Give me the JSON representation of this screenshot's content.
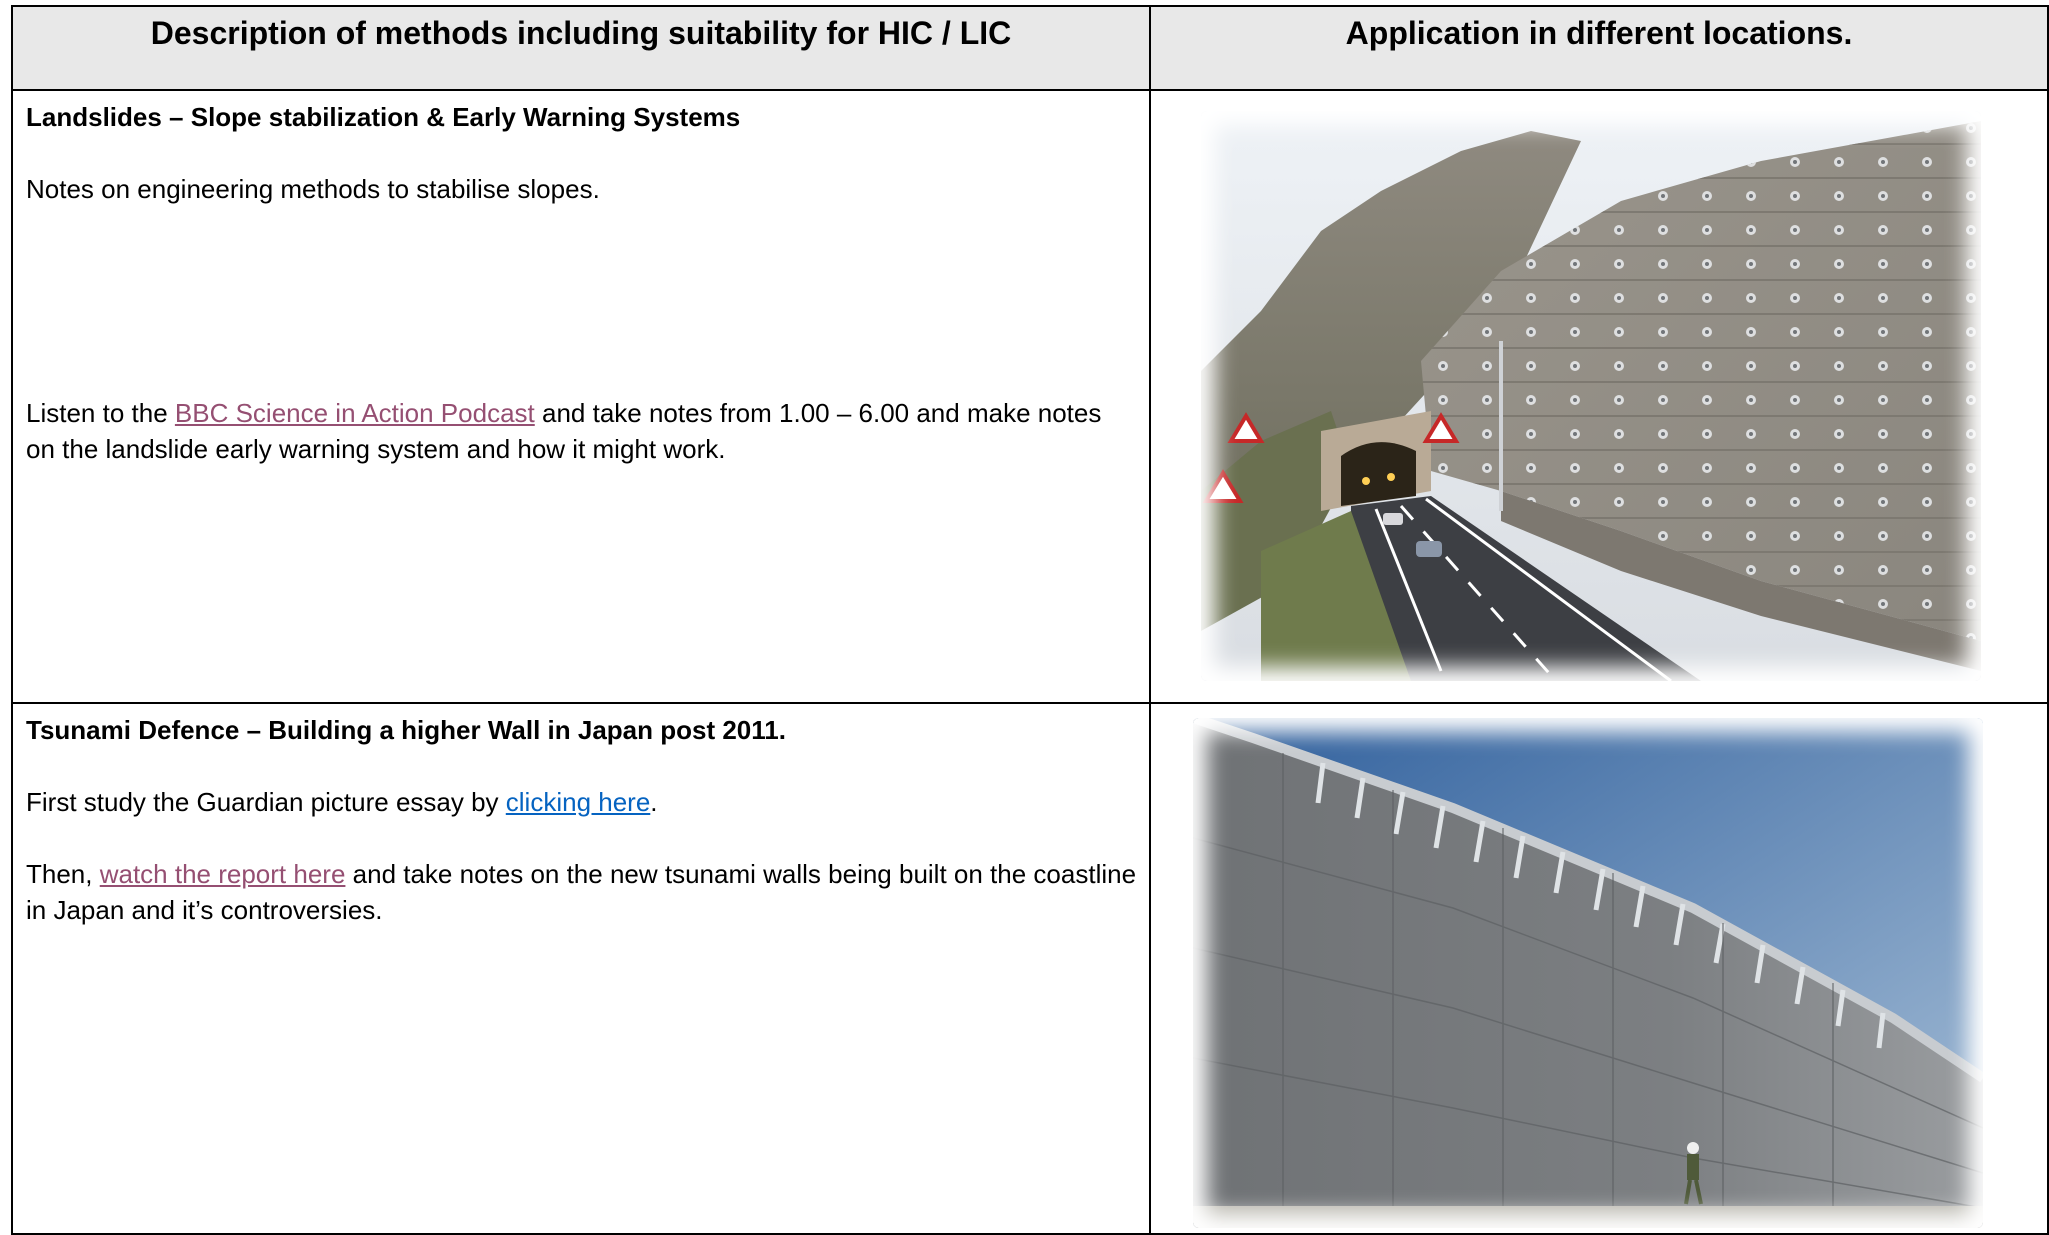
{
  "header": {
    "left": "Description of methods including suitability for HIC / LIC",
    "right": "Application in different locations."
  },
  "landslides": {
    "title": "Landslides – Slope stabilization & Early Warning Systems",
    "notes": "Notes on engineering methods to stabilise slopes.",
    "listen_prefix": "Listen to the ",
    "listen_link": "BBC Science in Action Podcast",
    "listen_suffix": " and take notes from 1.00 – 6.00 and make notes on the landslide early warning system and how it might work."
  },
  "tsunami": {
    "title": "Tsunami Defence – Building a higher Wall in Japan post 2011.",
    "study_prefix": "First study the Guardian picture essay by ",
    "study_link": "clicking here",
    "study_suffix": ".",
    "watch_prefix": "Then, ",
    "watch_link": "watch the report here",
    "watch_suffix": " and take notes on the new tsunami walls being built on the coastline in Japan and it’s controversies."
  },
  "colors": {
    "header_bg": "#e8e8e8",
    "link_visited": "#954f72",
    "link_new": "#0563c1"
  },
  "images": {
    "photo_1": "slope-stabilization-road-tunnel-photo",
    "photo_2": "tsunami-sea-wall-photo"
  }
}
